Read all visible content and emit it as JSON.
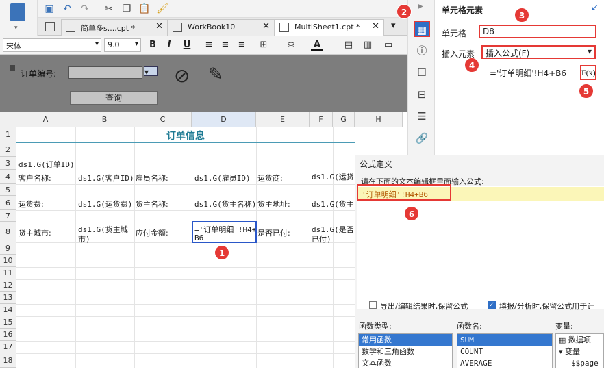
{
  "tabs": [
    {
      "label": "简单多s....cpt *",
      "icon": "grid-icon"
    },
    {
      "label": "WorkBook10",
      "icon": "grid-icon"
    },
    {
      "label": "MultiSheet1.cpt *",
      "icon": "grid-icon"
    }
  ],
  "format": {
    "font": "宋体",
    "size": "9.0",
    "bold": "B",
    "italic": "I",
    "underline": "U",
    "fill_icon": "fill-bucket-icon",
    "font_color_label": "A"
  },
  "param": {
    "order_label": "订单编号:",
    "query_label": "查询"
  },
  "grid": {
    "columns": [
      "A",
      "B",
      "C",
      "D",
      "E",
      "F",
      "G",
      "H"
    ],
    "rows": [
      "1",
      "2",
      "3",
      "4",
      "5",
      "6",
      "7",
      "8",
      "9",
      "10",
      "11",
      "12",
      "13",
      "14",
      "15",
      "16",
      "17",
      "18"
    ],
    "title": "订单信息",
    "a3": "ds1.G(订单ID)",
    "a4": "客户名称:",
    "b4": "ds1.G(客户ID)",
    "c4": "雇员名称:",
    "d4": "ds1.G(雇员ID)",
    "e4": "运货商:",
    "f4": "ds1.G(运货",
    "a6": "运货费:",
    "b6": "ds1.G(运货费)",
    "c6": "货主名称:",
    "d6": "ds1.G(货主名称)",
    "e6": "货主地址:",
    "f6": "ds1.G(货主",
    "a8": "货主城市:",
    "b8_1": "ds1.G(货主城",
    "b8_2": "市)",
    "c8": "应付金额:",
    "d8_1": "='订单明细'!H4+",
    "d8_2": "B6",
    "e8": "是否已付:",
    "f8_1": "ds1.G(是否",
    "f8_2": "已付)"
  },
  "panel": {
    "title": "单元格元素",
    "cell_label": "单元格",
    "cell_value": "D8",
    "insert_label": "插入元素",
    "insert_value": "插入公式(F)",
    "formula_value": "='订单明细'!H4+B6",
    "fx_label": "F(x)"
  },
  "dialog": {
    "title": "公式定义",
    "prompt": "请在下面的文本编辑框里面输入公式:",
    "formula": "'订单明细'!H4+B6",
    "opt1": "导出/编辑结果时,保留公式",
    "opt2": "填报/分析时,保留公式用于计",
    "ftype_label": "函数类型:",
    "fname_label": "函数名:",
    "var_label": "变量:",
    "ftypes": [
      "常用函数",
      "数学和三角函数",
      "文本函数"
    ],
    "fnames": [
      "SUM",
      "COUNT",
      "AVERAGE"
    ],
    "vars": [
      "数据项",
      "变量",
      "$$page"
    ]
  },
  "badges": [
    "1",
    "2",
    "3",
    "4",
    "5",
    "6"
  ]
}
